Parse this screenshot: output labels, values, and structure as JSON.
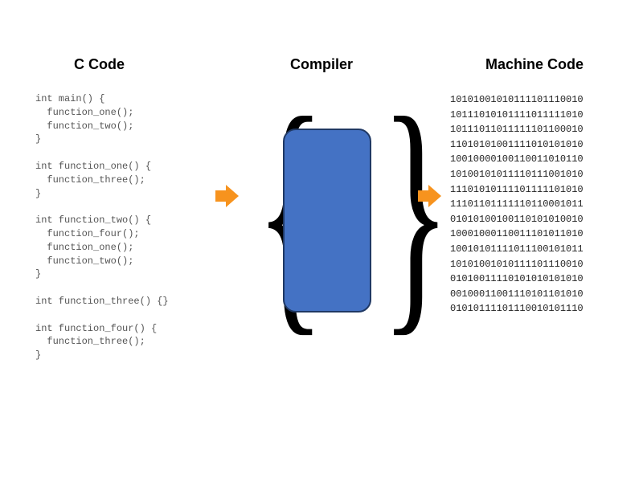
{
  "headings": {
    "left": "C Code",
    "center": "Compiler",
    "right": "Machine Code"
  },
  "c_code": "int main() {\n  function_one();\n  function_two();\n}\n\nint function_one() {\n  function_three();\n}\n\nint function_two() {\n  function_four();\n  function_one();\n  function_two();\n}\n\nint function_three() {}\n\nint function_four() {\n  function_three();\n}",
  "machine_code_lines": [
    "10101001010111101110010",
    "10111010101111011111010",
    "10111011011111101100010",
    "11010101001111010101010",
    "10010000100110011010110",
    "10100101011110111001010",
    "11101010111101111101010",
    "11101101111110110001011",
    "01010100100110101010010",
    "10001000110011101011010",
    "10010101111011100101011",
    "10101001010111101110010",
    "01010011110101010101010",
    "00100011001110101101010",
    "01010111101110010101110"
  ]
}
